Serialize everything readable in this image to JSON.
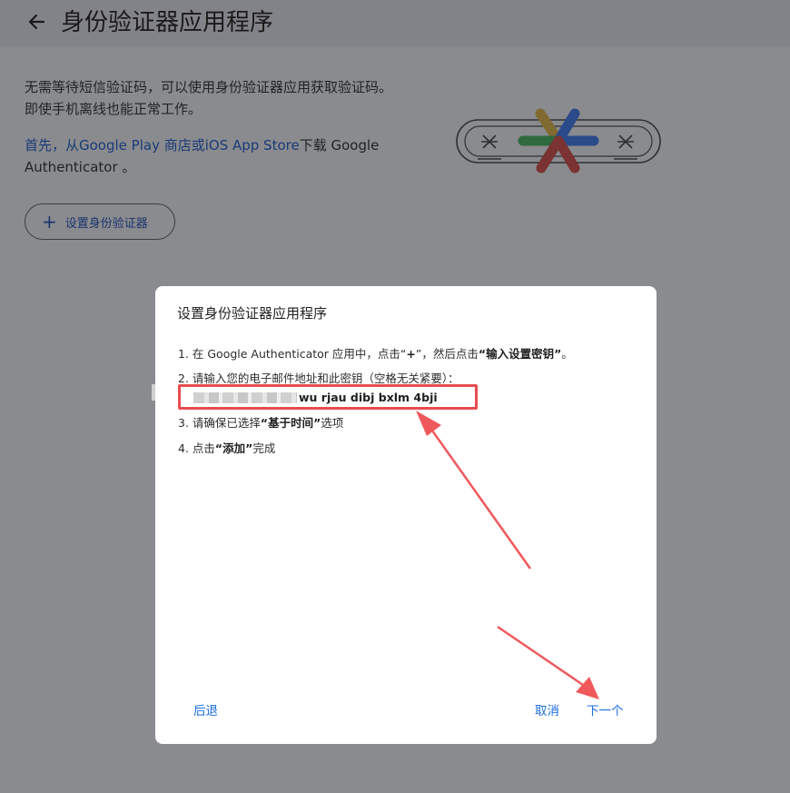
{
  "header": {
    "title": "身份验证器应用程序"
  },
  "intro": {
    "text": "无需等待短信验证码，可以使用身份验证器应用获取验证码。即使手机离线也能正常工作。"
  },
  "download": {
    "link_text": "首先，从Google Play 商店或iOS App Store",
    "rest_text": "下载 Google Authenticator 。"
  },
  "setup_button": {
    "label": "设置身份验证器"
  },
  "dialog": {
    "title": "设置身份验证器应用程序",
    "step1": {
      "prefix": "1. 在 Google Authenticator 应用中，点击“",
      "plus": "+",
      "mid": "”，然后点击",
      "bold": "“输入设置密钥”",
      "suffix": "。"
    },
    "step2": {
      "text": "2. 请输入您的电子邮件地址和此密钥（空格无关紧要）："
    },
    "secret_key": "wu rjau dibj bxlm 4bji",
    "step3": {
      "prefix": "3. 请确保已选择",
      "bold": "“基于时间”",
      "suffix": "选项"
    },
    "step4": {
      "prefix": "4. 点击",
      "bold": "“添加”",
      "suffix": "完成"
    },
    "back_label": "后退",
    "cancel_label": "取消",
    "next_label": "下一个"
  },
  "colors": {
    "overlay": "#8a8b8e",
    "link": "#1b6ee0",
    "highlight": "#e84c50"
  }
}
